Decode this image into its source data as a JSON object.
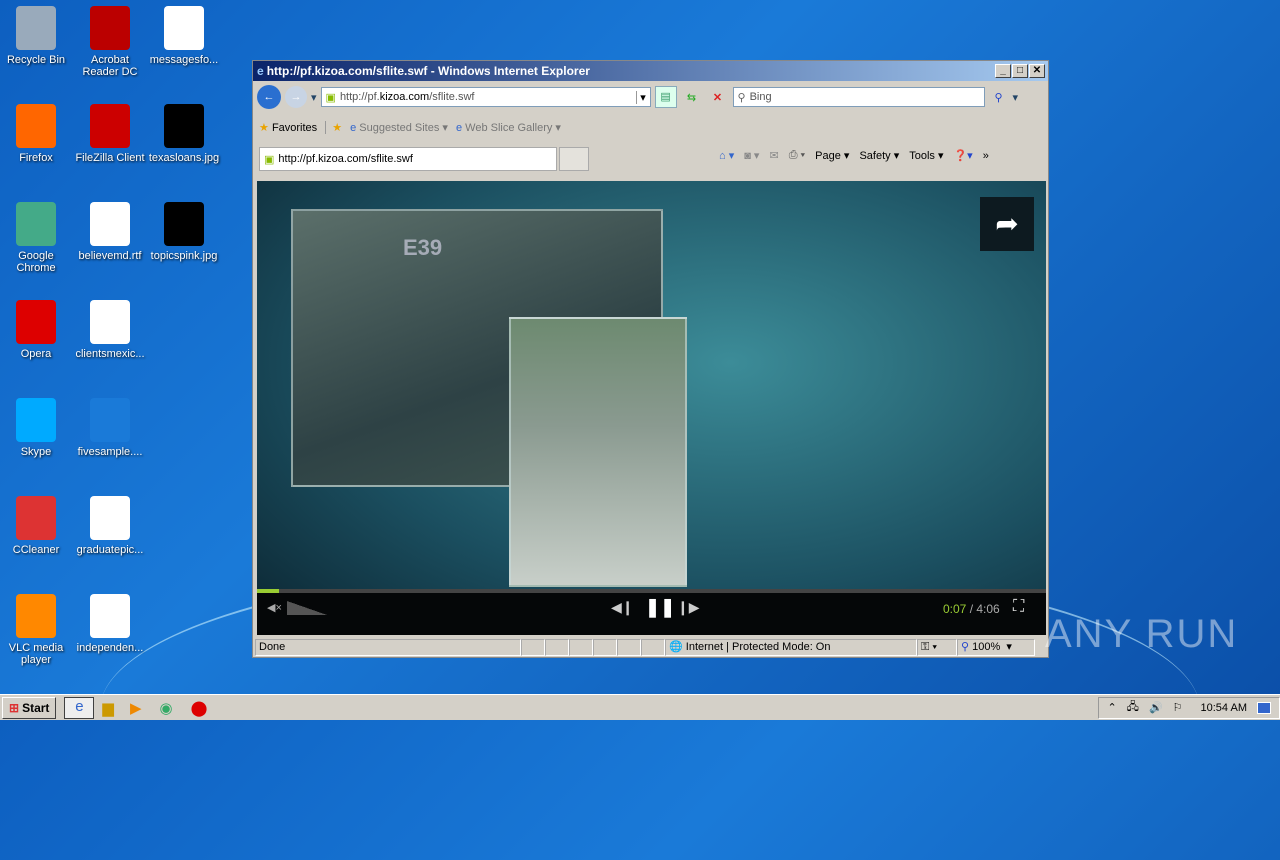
{
  "desktop_icons": [
    {
      "label": "Recycle Bin",
      "col": 0,
      "row": 0,
      "color": "#9ab"
    },
    {
      "label": "Acrobat Reader DC",
      "col": 1,
      "row": 0,
      "color": "#b00"
    },
    {
      "label": "messagesfo...",
      "col": 2,
      "row": 0,
      "color": "#fff"
    },
    {
      "label": "Firefox",
      "col": 0,
      "row": 1,
      "color": "#f60"
    },
    {
      "label": "FileZilla Client",
      "col": 1,
      "row": 1,
      "color": "#c00"
    },
    {
      "label": "texasloans.jpg",
      "col": 2,
      "row": 1,
      "color": "#000"
    },
    {
      "label": "Google Chrome",
      "col": 0,
      "row": 2,
      "color": "#4a8"
    },
    {
      "label": "believemd.rtf",
      "col": 1,
      "row": 2,
      "color": "#fff"
    },
    {
      "label": "topicspink.jpg",
      "col": 2,
      "row": 2,
      "color": "#000"
    },
    {
      "label": "Opera",
      "col": 0,
      "row": 3,
      "color": "#d00"
    },
    {
      "label": "clientsmexic...",
      "col": 1,
      "row": 3,
      "color": "#fff"
    },
    {
      "label": "Skype",
      "col": 0,
      "row": 4,
      "color": "#0af"
    },
    {
      "label": "fivesample....",
      "col": 1,
      "row": 4,
      "color": "#1a7ad8"
    },
    {
      "label": "CCleaner",
      "col": 0,
      "row": 5,
      "color": "#d33"
    },
    {
      "label": "graduatepic...",
      "col": 1,
      "row": 5,
      "color": "#fff"
    },
    {
      "label": "VLC media player",
      "col": 0,
      "row": 6,
      "color": "#f80"
    },
    {
      "label": "independen...",
      "col": 1,
      "row": 6,
      "color": "#fff"
    }
  ],
  "window": {
    "title": "http://pf.kizoa.com/sflite.swf - Windows Internet Explorer",
    "address_prefix": "http://pf.",
    "address_domain": "kizoa.com",
    "address_suffix": "/sflite.swf",
    "search_placeholder": "Bing",
    "favorites": "Favorites",
    "suggested": "Suggested Sites",
    "webslice": "Web Slice Gallery",
    "tab_label": "http://pf.kizoa.com/sflite.swf",
    "cmd": {
      "page": "Page",
      "safety": "Safety",
      "tools": "Tools"
    },
    "status": "Done",
    "zone": "Internet | Protected Mode: On",
    "zoom": "100%"
  },
  "player": {
    "current": "0:07",
    "total": "4:06",
    "separator": " / ",
    "progress_fraction": 0.028,
    "overlay_text": "E39"
  },
  "taskbar": {
    "start": "Start",
    "time": "10:54 AM"
  },
  "watermark": "ANY RUN"
}
